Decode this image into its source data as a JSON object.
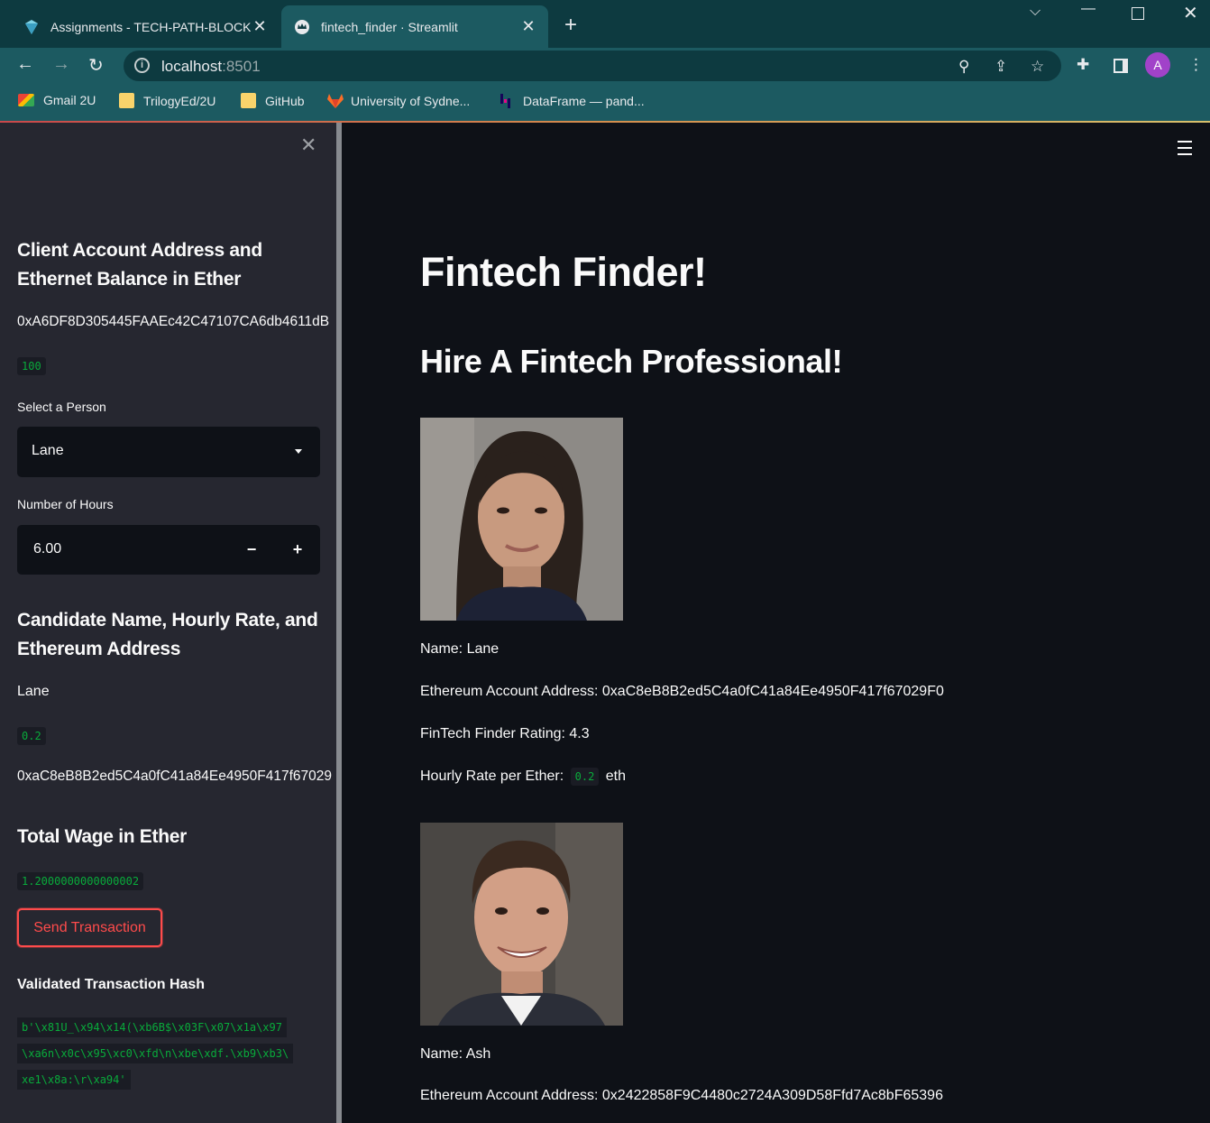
{
  "browser": {
    "tabs": [
      {
        "title": "Assignments - TECH-PATH-BLOCKCHAIN",
        "active": false
      },
      {
        "title": "fintech_finder · Streamlit",
        "active": true
      }
    ],
    "url_host": "localhost",
    "url_port": ":8501",
    "profile_initial": "A",
    "bookmarks": [
      {
        "label": "Gmail 2U",
        "icon": "gmail-icon"
      },
      {
        "label": "TrilogyEd/2U",
        "icon": "folder-icon"
      },
      {
        "label": "GitHub",
        "icon": "folder-icon"
      },
      {
        "label": "University of Sydne...",
        "icon": "gitlab-icon"
      },
      {
        "label": "DataFrame — pand...",
        "icon": "pandas-icon"
      }
    ]
  },
  "sidebar": {
    "account_heading": "Client Account Address and Ethernet Balance in Ether",
    "account_address": "0xA6DF8D305445FAAEc42C47107CA6db4611dB",
    "balance": "100",
    "select_label": "Select a Person",
    "select_value": "Lane",
    "hours_label": "Number of Hours",
    "hours_value": "6.00",
    "decrement": "−",
    "increment": "+",
    "candidate_heading": "Candidate Name, Hourly Rate, and Ethereum Address",
    "candidate_name": "Lane",
    "candidate_rate": "0.2",
    "candidate_address": "0xaC8eB8B2ed5C4a0fC41a84Ee4950F417f67029",
    "wage_heading": "Total Wage in Ether",
    "wage_value": "1.2000000000000002",
    "send_button": "Send Transaction",
    "hash_heading": "Validated Transaction Hash",
    "hash_lines": [
      "b'\\x81U_\\x94\\x14(\\xb6B$\\x03F\\x07\\x1a\\x97",
      "\\xa6n\\x0c\\x95\\xc0\\xfd\\n\\xbe\\xdf.\\xb9\\xb3\\",
      "xe1\\x8a:\\r\\xa94'"
    ]
  },
  "main": {
    "title": "Fintech Finder!",
    "subtitle": "Hire A Fintech Professional!",
    "candidates": [
      {
        "name": "Name: Lane",
        "address": "Ethereum Account Address: 0xaC8eB8B2ed5C4a0fC41a84Ee4950F417f67029F0",
        "rating": "FinTech Finder Rating: 4.3",
        "rate_label": "Hourly Rate per Ether:",
        "rate_value": "0.2",
        "rate_unit": "eth"
      },
      {
        "name": "Name: Ash",
        "address": "Ethereum Account Address: 0x2422858F9C4480c2724A309D58Ffd7Ac8bF65396"
      }
    ]
  }
}
